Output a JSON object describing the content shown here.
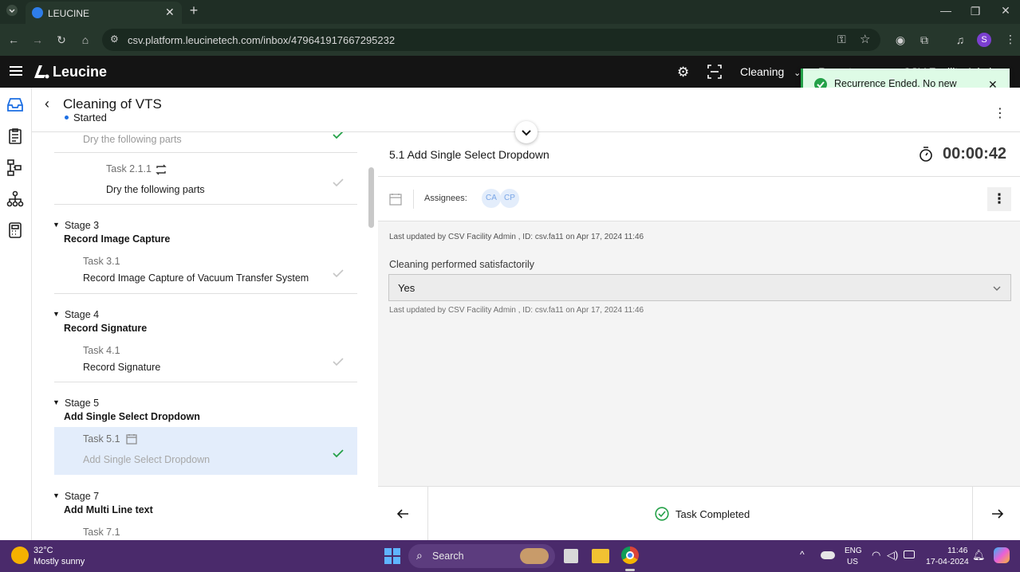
{
  "browser": {
    "tab_title": "LEUCINE",
    "url": "csv.platform.leucinetech.com/inbox/479641917667295232",
    "profile_initial": "S"
  },
  "app": {
    "logo_text": "Leucine",
    "facility_selector": "Cleaning",
    "user_partial": "CSV Facility Admin",
    "header_partial": "Reports"
  },
  "job": {
    "title": "Cleaning of VTS",
    "status": "Started"
  },
  "tasklist": {
    "partial_top": "Dry the following parts",
    "stages": [
      {
        "label": "Stage 3",
        "title": "Record Image Capture",
        "tasks": [
          {
            "id": "Task 3.1",
            "name": "Record Image Capture of Vacuum Transfer System"
          }
        ]
      },
      {
        "label": "Stage 4",
        "title": "Record Signature",
        "tasks": [
          {
            "id": "Task 4.1",
            "name": "Record Signature"
          }
        ]
      },
      {
        "label": "Stage 5",
        "title": "Add Single Select Dropdown",
        "tasks": [
          {
            "id": "Task 5.1",
            "name": "Add Single Select Dropdown"
          }
        ]
      },
      {
        "label": "Stage 7",
        "title": "Add Multi Line text",
        "tasks": [
          {
            "id": "Task 7.1",
            "name": ""
          }
        ]
      }
    ],
    "task_2_1_1": {
      "id": "Task 2.1.1",
      "name": "Dry the following parts"
    }
  },
  "task": {
    "title": "5.1 Add Single Select Dropdown",
    "timer": "00:00:42",
    "assignees_label": "Assignees:",
    "assignees": [
      "CA",
      "CP"
    ],
    "last_updated_1": "Last updated by CSV Facility Admin , ID: csv.fa11 on Apr 17, 2024 11:46",
    "param_label": "Cleaning performed satisfactorily",
    "param_value": "Yes",
    "last_updated_2": "Last updated by CSV Facility Admin , ID: csv.fa11 on Apr 17, 2024 11:46"
  },
  "footer": {
    "status": "Task Completed"
  },
  "toast": {
    "message": "Recurrence Ended. No new recurring task can be created."
  },
  "taskbar": {
    "weather_temp": "32°C",
    "weather_desc": "Mostly sunny",
    "search_label": "Search",
    "lang_1": "ENG",
    "lang_2": "US",
    "time": "11:46",
    "date": "17-04-2024"
  },
  "colors": {
    "success": "#24a148",
    "accent_blue": "#1d6fe3",
    "selected_row": "#e3edfb",
    "taskbar": "#4a2a6b"
  }
}
